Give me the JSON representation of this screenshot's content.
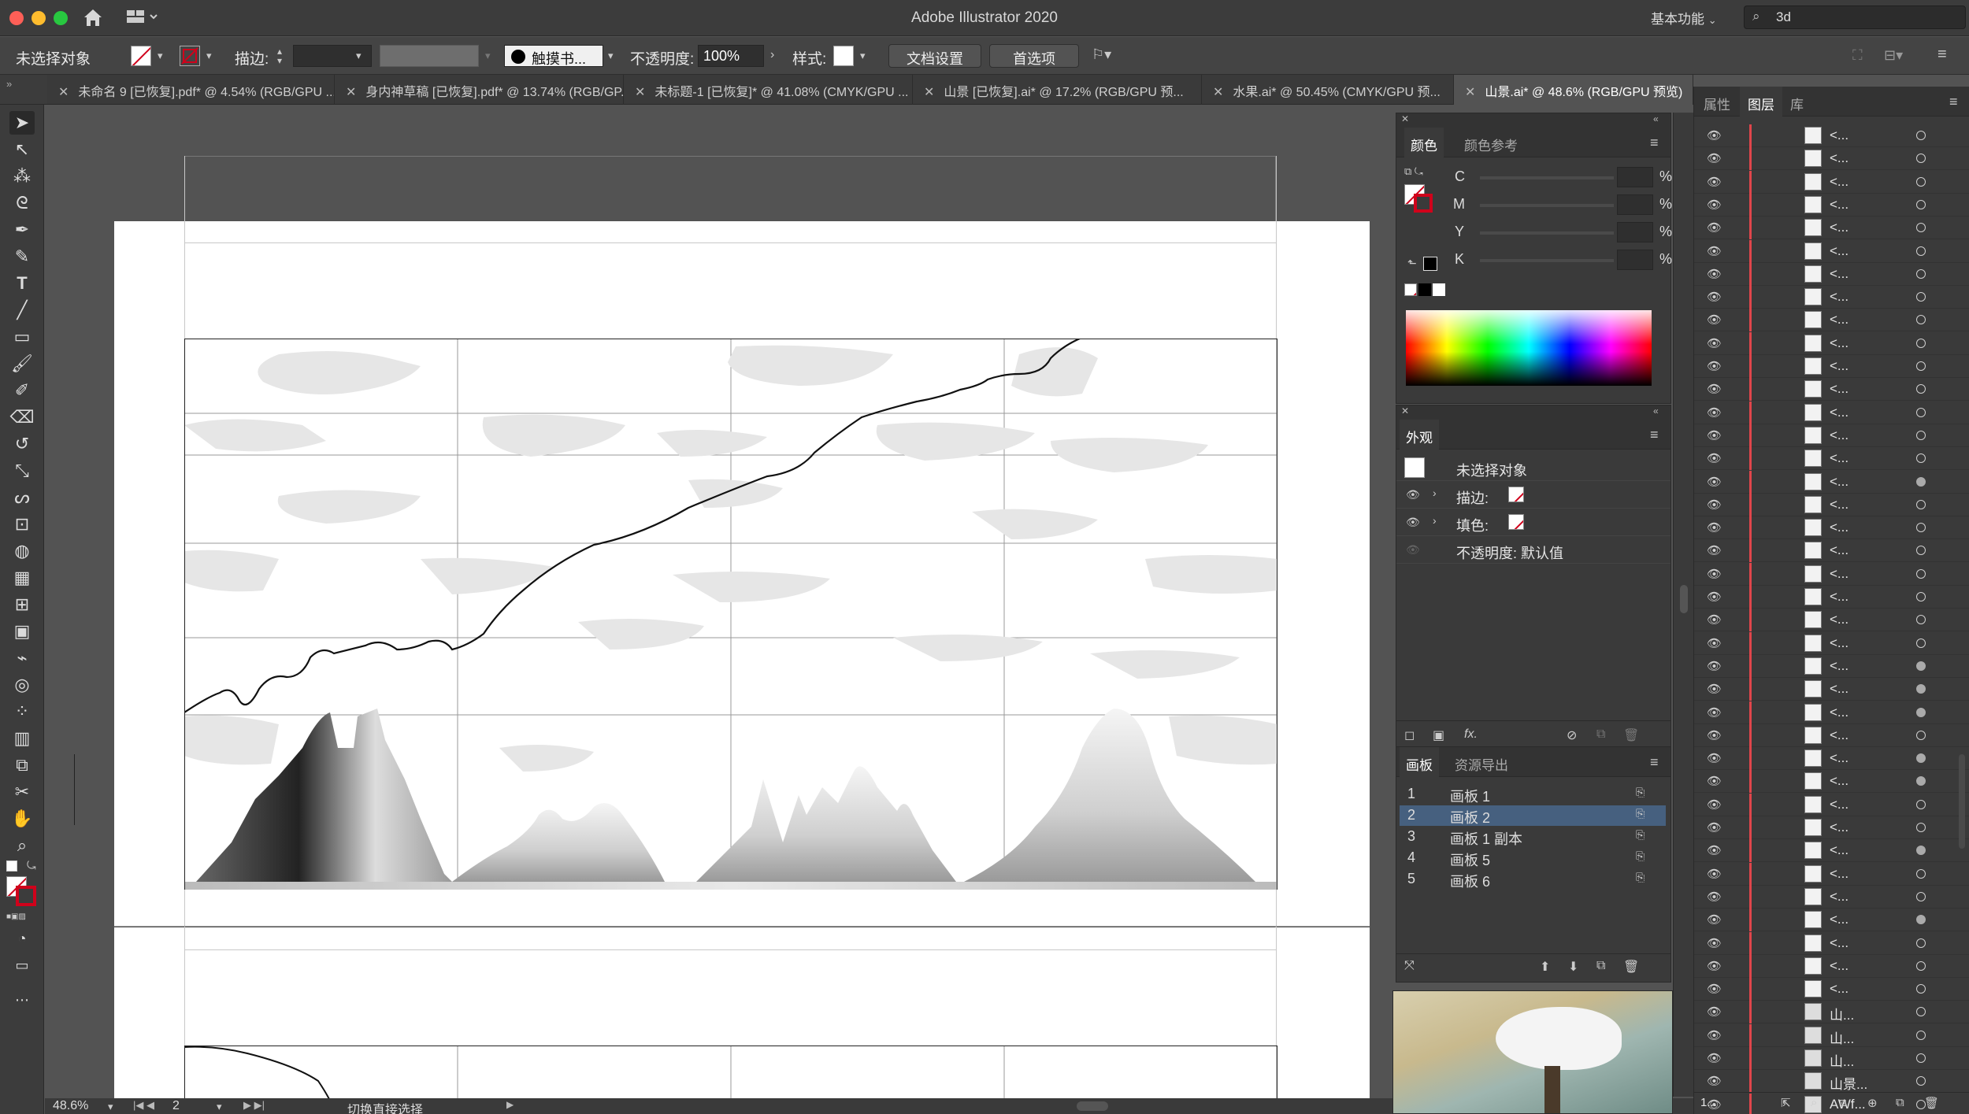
{
  "window": {
    "title": "Adobe Illustrator 2020",
    "workspace": "基本功能",
    "search_value": "3d"
  },
  "control_bar": {
    "selection_status": "未选择对象",
    "stroke_label": "描边:",
    "brush_label": "触摸书...",
    "opacity_label": "不透明度:",
    "opacity_value": "100%",
    "style_label": "样式:",
    "doc_setup_button": "文档设置",
    "preferences_button": "首选项"
  },
  "document_tabs": [
    {
      "label": "未命名 9 [已恢复].pdf* @ 4.54% (RGB/GPU ...",
      "active": false
    },
    {
      "label": "身内神草稿 [已恢复].pdf* @ 13.74% (RGB/GP...",
      "active": false
    },
    {
      "label": "未标题-1 [已恢复]* @ 41.08% (CMYK/GPU ...",
      "active": false
    },
    {
      "label": "山景 [已恢复].ai* @ 17.2% (RGB/GPU 预...",
      "active": false
    },
    {
      "label": "水果.ai* @ 50.45% (CMYK/GPU 预...",
      "active": false
    },
    {
      "label": "山景.ai* @ 48.6% (RGB/GPU 预览)",
      "active": true
    }
  ],
  "color_panel": {
    "tabs": [
      "颜色",
      "颜色参考"
    ],
    "channels": [
      {
        "label": "C",
        "unit": "%"
      },
      {
        "label": "M",
        "unit": "%"
      },
      {
        "label": "Y",
        "unit": "%"
      },
      {
        "label": "K",
        "unit": "%"
      }
    ]
  },
  "appearance_panel": {
    "title": "外观",
    "selection": "未选择对象",
    "stroke": "描边:",
    "fill": "填色:",
    "opacity": "不透明度: 默认值",
    "fx": "fx."
  },
  "artboards_panel": {
    "tabs": [
      "画板",
      "资源导出"
    ],
    "rows": [
      {
        "num": "1",
        "name": "画板 1",
        "selected": false
      },
      {
        "num": "2",
        "name": "画板 2",
        "selected": true
      },
      {
        "num": "3",
        "name": "画板 1 副本",
        "selected": false
      },
      {
        "num": "4",
        "name": "画板 5",
        "selected": false
      },
      {
        "num": "5",
        "name": "画板 6",
        "selected": false
      }
    ]
  },
  "right_tabs": [
    "属性",
    "图层",
    "库"
  ],
  "layers": {
    "generic_name": "<...",
    "named": [
      "山...",
      "山...",
      "山...",
      "山景...",
      "AWf..."
    ],
    "footer_count": "1..."
  },
  "status_bar": {
    "zoom": "48.6%",
    "artboard_number": "2",
    "tool_hint": "切换直接选择"
  },
  "colors": {
    "accent_selection": "#46607f",
    "layer_color": "#e0454b",
    "none_slash": "#d0021b"
  }
}
